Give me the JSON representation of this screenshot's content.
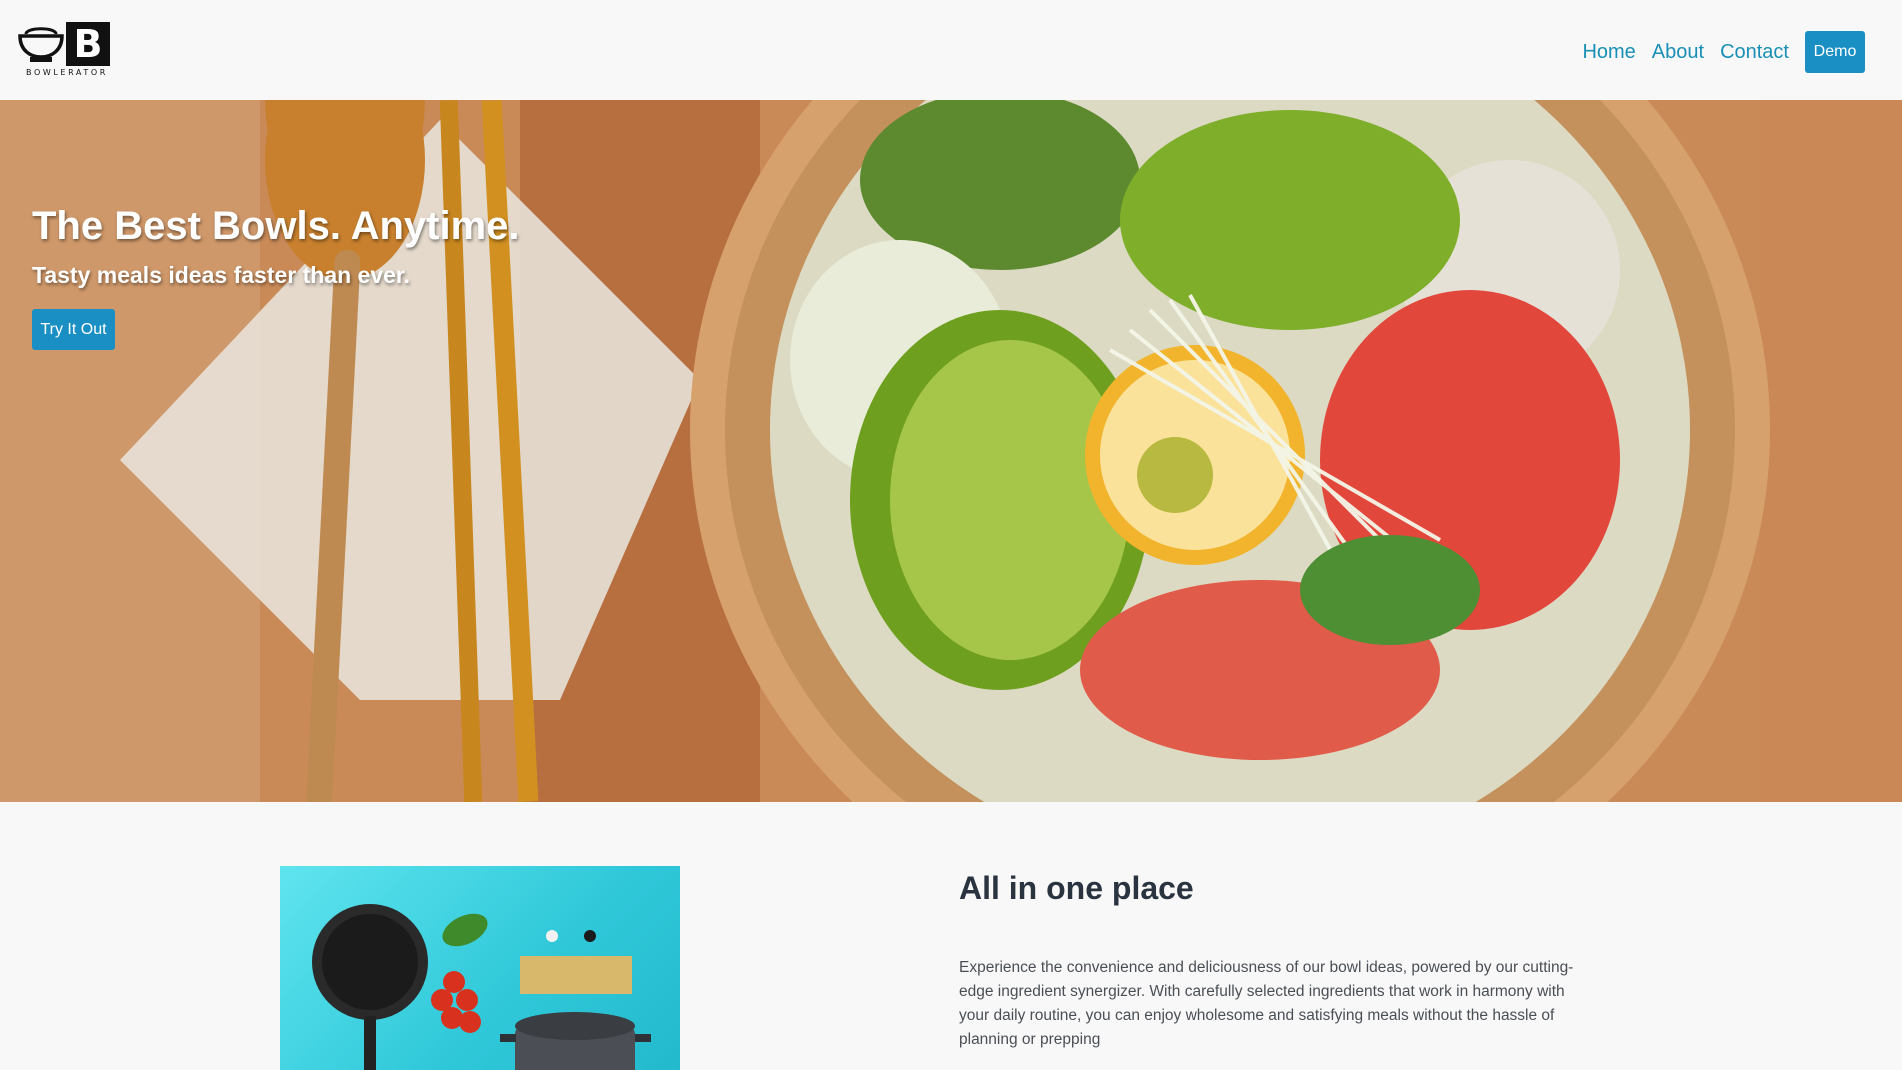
{
  "brand": {
    "name": "BOWLERATOR",
    "letter": "B"
  },
  "nav": {
    "links": [
      "Home",
      "About",
      "Contact"
    ],
    "demo_label": "Demo"
  },
  "hero": {
    "title": "The Best Bowls. Anytime.",
    "subtitle": "Tasty meals ideas faster than ever.",
    "cta_label": "Try It Out"
  },
  "feature": {
    "title": "All in one place",
    "text": "Experience the convenience and deliciousness of our bowl ideas, powered by our cutting-edge ingredient synergizer. With carefully selected ingredients that work in harmony with your daily routine, you can enjoy wholesome and satisfying meals without the hassle of planning or prepping"
  },
  "colors": {
    "accent": "#1a8fc4",
    "link": "#1a8fb6",
    "background": "#f8f8f8"
  }
}
